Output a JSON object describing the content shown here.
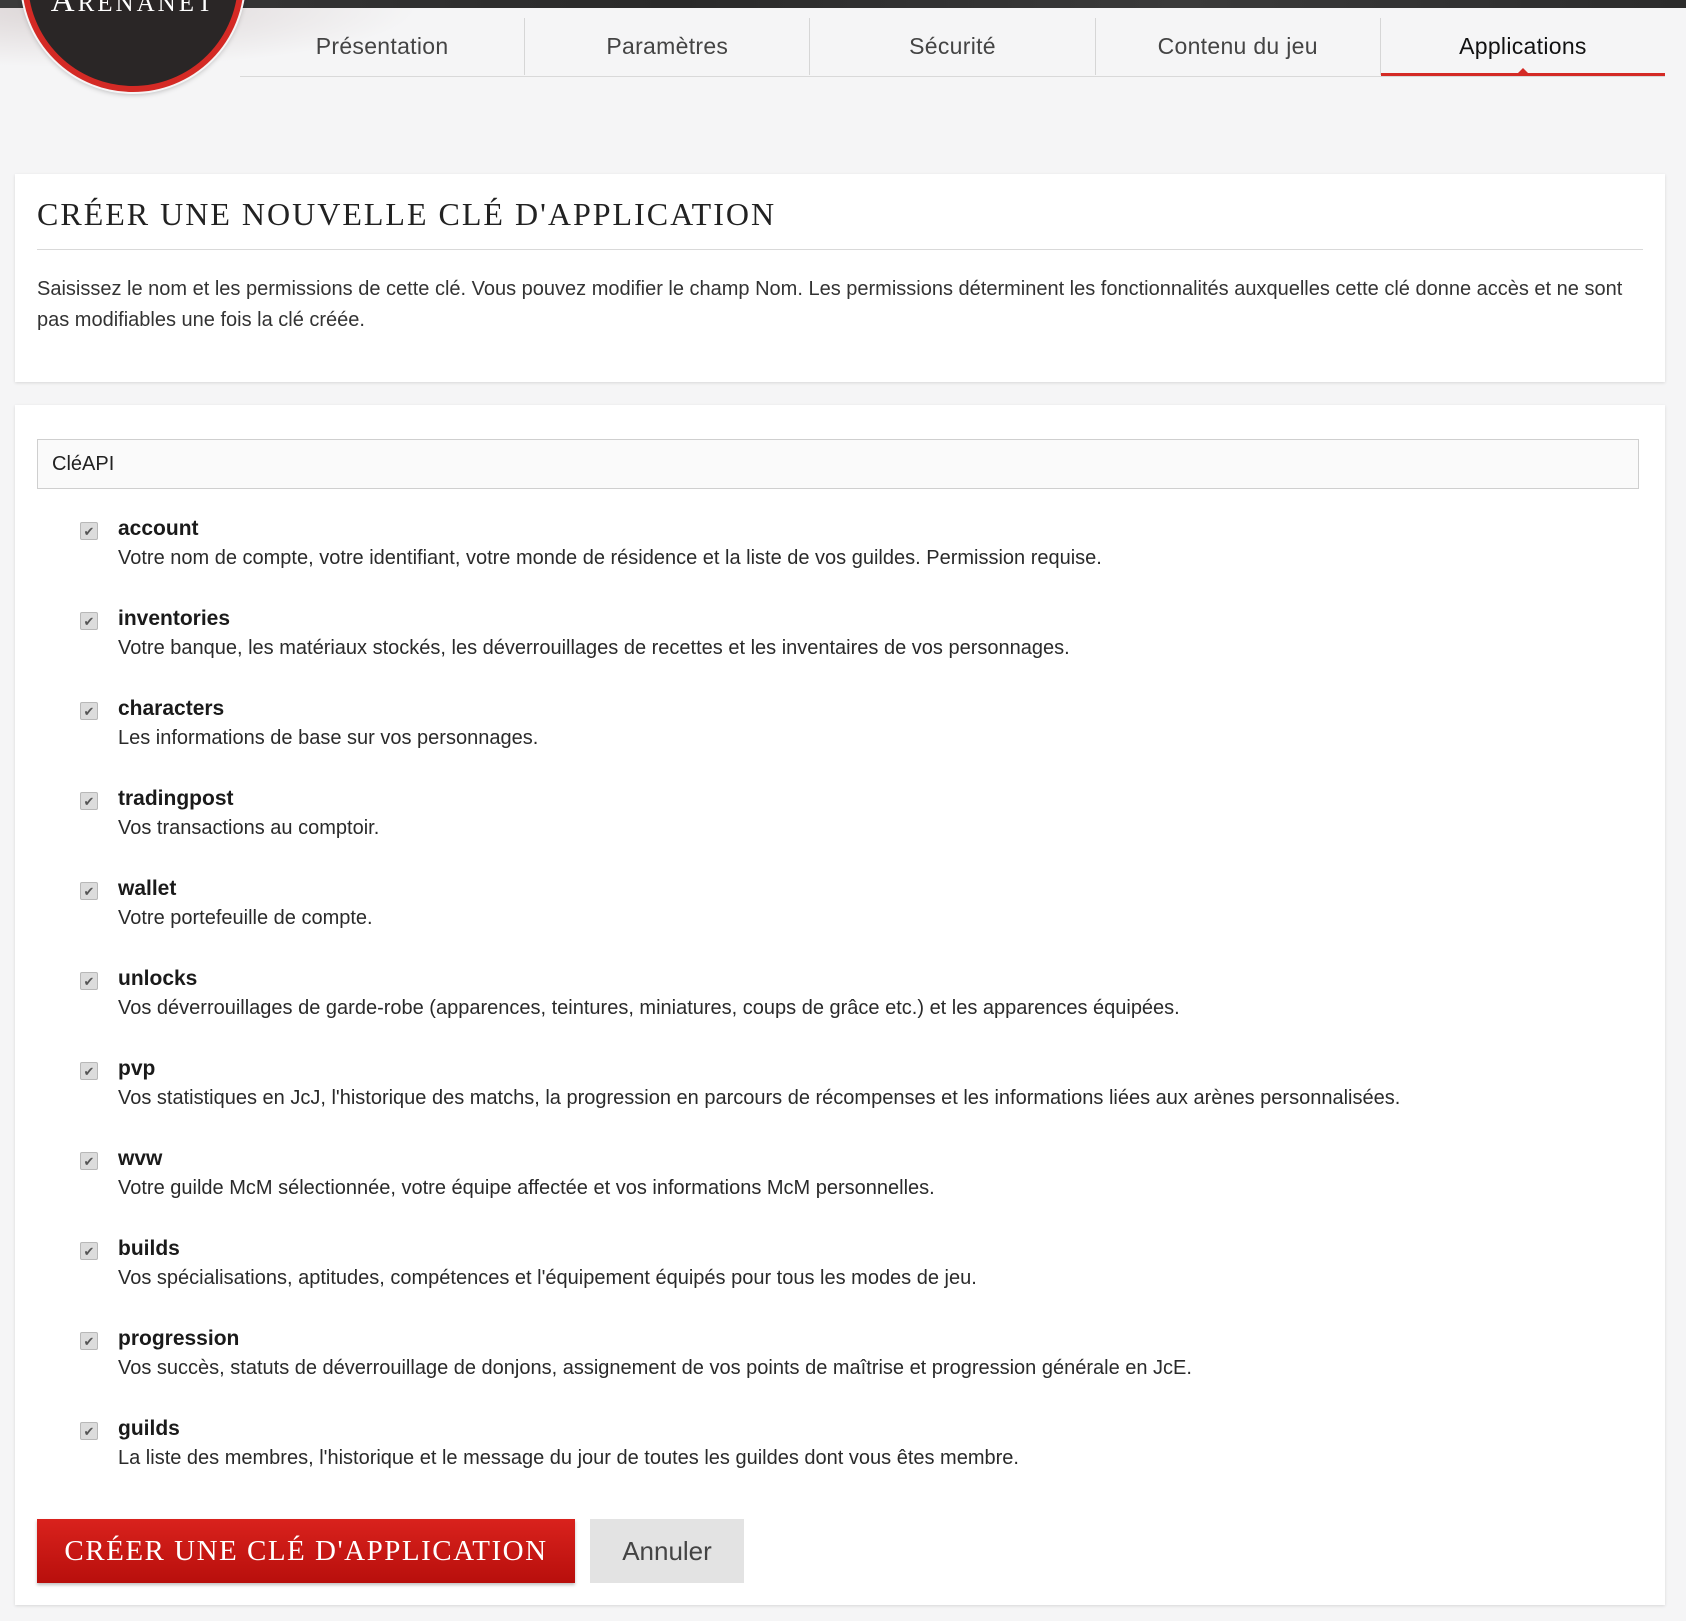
{
  "brand": {
    "logo_text_first": "A",
    "logo_text_rest": "RENANET"
  },
  "tabs": [
    {
      "label": "Présentation"
    },
    {
      "label": "Paramètres"
    },
    {
      "label": "Sécurité"
    },
    {
      "label": "Contenu du jeu"
    },
    {
      "label": "Applications"
    }
  ],
  "active_tab": "Applications",
  "accent_color": "#d42a25",
  "intro": {
    "title": "CRÉER UNE NOUVELLE CLÉ D'APPLICATION",
    "description": "Saisissez le nom et les permissions de cette clé. Vous pouvez modifier le champ Nom. Les permissions déterminent les fonctionnalités auxquelles cette clé donne accès et ne sont pas modifiables une fois la clé créée."
  },
  "form": {
    "name_value": "CléAPI",
    "permissions": [
      {
        "name": "account",
        "description": "Votre nom de compte, votre identifiant, votre monde de résidence et la liste de vos guildes. Permission requise.",
        "checked": true
      },
      {
        "name": "inventories",
        "description": "Votre banque, les matériaux stockés, les déverrouillages de recettes et les inventaires de vos personnages.",
        "checked": true
      },
      {
        "name": "characters",
        "description": "Les informations de base sur vos personnages.",
        "checked": true
      },
      {
        "name": "tradingpost",
        "description": "Vos transactions au comptoir.",
        "checked": true
      },
      {
        "name": "wallet",
        "description": "Votre portefeuille de compte.",
        "checked": true
      },
      {
        "name": "unlocks",
        "description": "Vos déverrouillages de garde-robe (apparences, teintures, miniatures, coups de grâce etc.) et les apparences équipées.",
        "checked": true
      },
      {
        "name": "pvp",
        "description": "Vos statistiques en JcJ, l'historique des matchs, la progression en parcours de récompenses et les informations liées aux arènes personnalisées.",
        "checked": true
      },
      {
        "name": "wvw",
        "description": "Votre guilde McM sélectionnée, votre équipe affectée et vos informations McM personnelles.",
        "checked": true
      },
      {
        "name": "builds",
        "description": "Vos spécialisations, aptitudes, compétences et l'équipement équipés pour tous les modes de jeu.",
        "checked": true
      },
      {
        "name": "progression",
        "description": "Vos succès, statuts de déverrouillage de donjons, assignement de vos points de maîtrise et progression générale en JcE.",
        "checked": true
      },
      {
        "name": "guilds",
        "description": "La liste des membres, l'historique et le message du jour de toutes les guildes dont vous êtes membre.",
        "checked": true
      }
    ],
    "create_label": "CRÉER UNE CLÉ D'APPLICATION",
    "cancel_label": "Annuler"
  }
}
